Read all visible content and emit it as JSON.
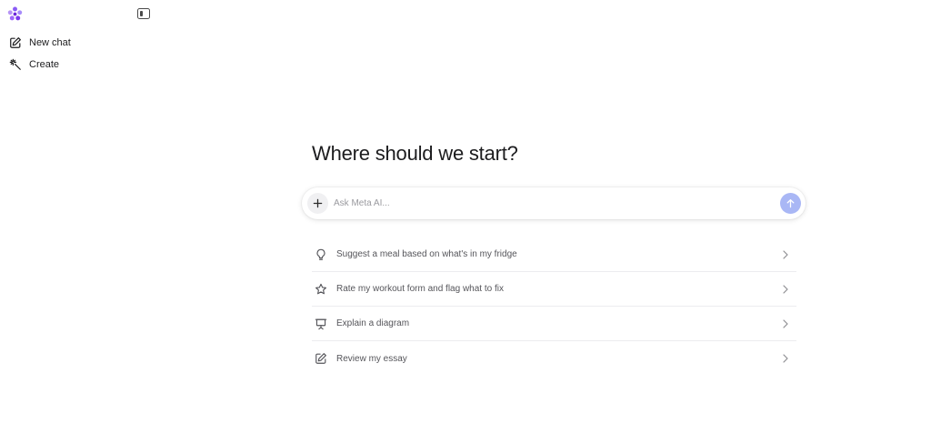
{
  "sidebar": {
    "logo_icon": "meta-ai-flower-icon",
    "collapse_icon": "sidebar-toggle-icon",
    "items": [
      {
        "label": "New chat",
        "icon": "edit-square-icon"
      },
      {
        "label": "Create",
        "icon": "magic-wand-icon"
      }
    ]
  },
  "main": {
    "heading": "Where should we start?",
    "composer": {
      "placeholder": "Ask Meta AI...",
      "value": "",
      "plus_icon": "plus-icon",
      "send_icon": "arrow-up-icon",
      "send_color": "#a9b7f5"
    },
    "suggestions": [
      {
        "label": "Suggest a meal based on what's in my fridge",
        "icon": "lightbulb-icon"
      },
      {
        "label": "Rate my workout form and flag what to fix",
        "icon": "star-icon"
      },
      {
        "label": "Explain a diagram",
        "icon": "presentation-board-icon"
      },
      {
        "label": "Review my essay",
        "icon": "edit-square-icon"
      }
    ]
  },
  "colors": {
    "logo_purple": "#8b5cf6",
    "accent": "#a9b7f5"
  }
}
